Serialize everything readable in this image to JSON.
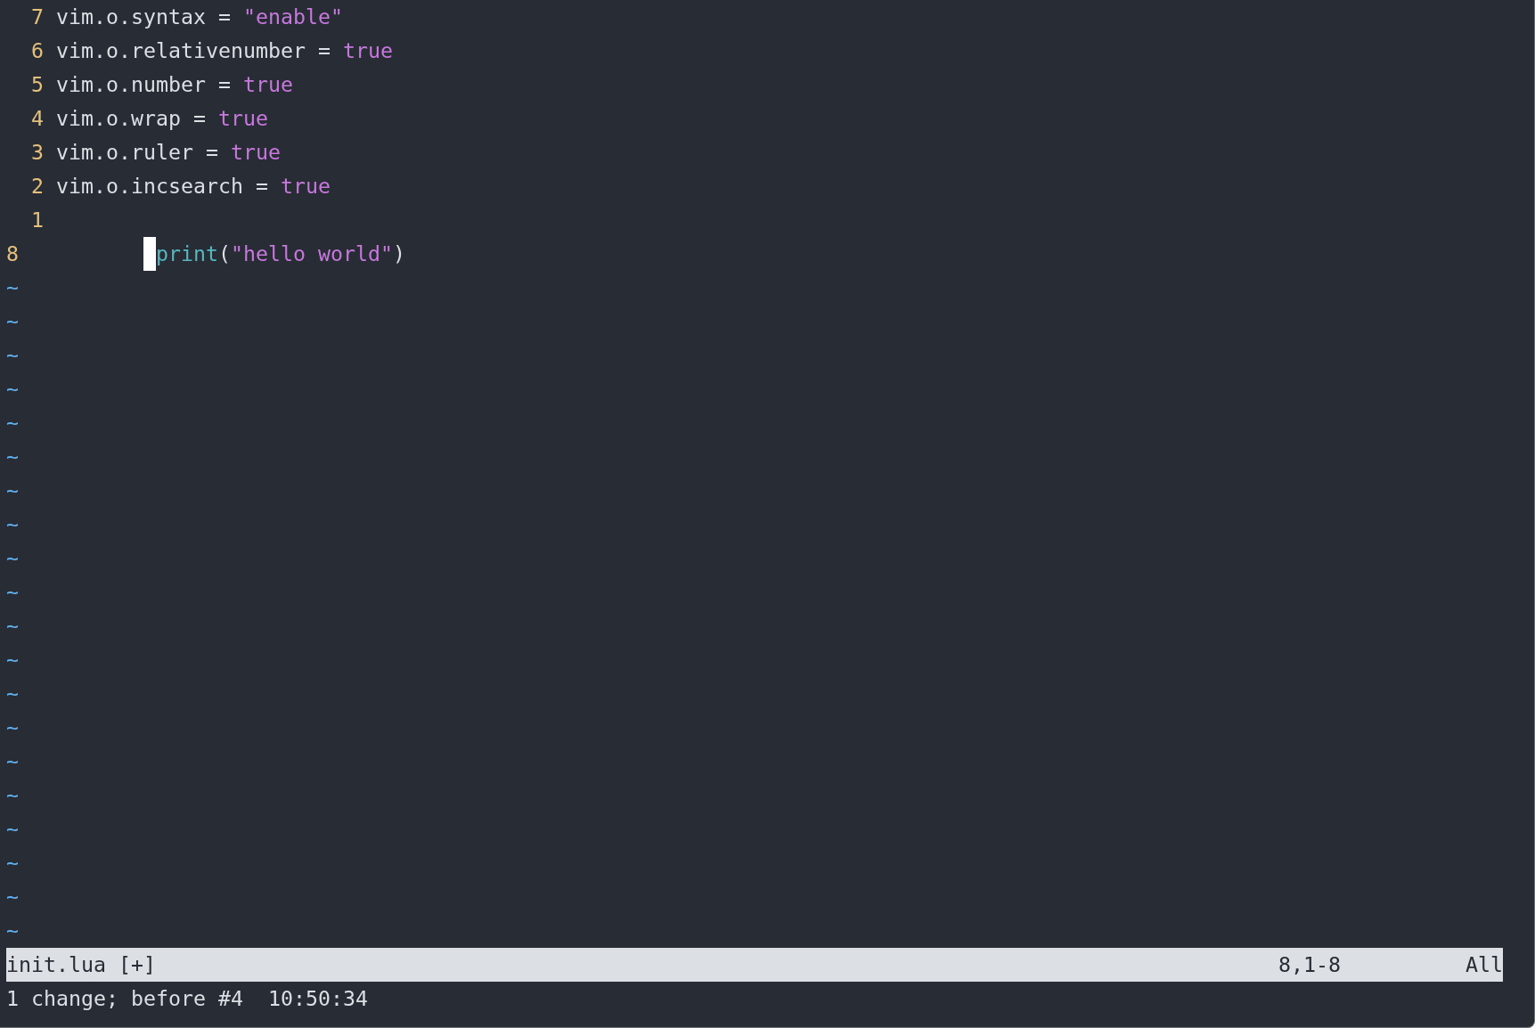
{
  "editor": {
    "lines": [
      {
        "number": "7",
        "cursor": false,
        "tokens": [
          {
            "kind": "plain",
            "text": "vim.o.syntax = "
          },
          {
            "kind": "string",
            "text": "\"enable\""
          }
        ]
      },
      {
        "number": "6",
        "cursor": false,
        "tokens": [
          {
            "kind": "plain",
            "text": "vim.o.relativenumber = "
          },
          {
            "kind": "boolean",
            "text": "true"
          }
        ]
      },
      {
        "number": "5",
        "cursor": false,
        "tokens": [
          {
            "kind": "plain",
            "text": "vim.o.number = "
          },
          {
            "kind": "boolean",
            "text": "true"
          }
        ]
      },
      {
        "number": "4",
        "cursor": false,
        "tokens": [
          {
            "kind": "plain",
            "text": "vim.o.wrap = "
          },
          {
            "kind": "boolean",
            "text": "true"
          }
        ]
      },
      {
        "number": "3",
        "cursor": false,
        "tokens": [
          {
            "kind": "plain",
            "text": "vim.o.ruler = "
          },
          {
            "kind": "boolean",
            "text": "true"
          }
        ]
      },
      {
        "number": "2",
        "cursor": false,
        "tokens": [
          {
            "kind": "plain",
            "text": "vim.o.incsearch = "
          },
          {
            "kind": "boolean",
            "text": "true"
          }
        ]
      },
      {
        "number": "1",
        "cursor": false
      },
      {
        "number": "8",
        "cursor": true,
        "tokens": [
          {
            "kind": "function",
            "text": "print"
          },
          {
            "kind": "plain",
            "text": "("
          },
          {
            "kind": "string",
            "text": "\"hello world\""
          },
          {
            "kind": "plain",
            "text": ")"
          }
        ]
      }
    ],
    "filler": [
      "~",
      "~",
      "~",
      "~",
      "~",
      "~",
      "~",
      "~",
      "~",
      "~",
      "~",
      "~",
      "~",
      "~",
      "~",
      "~",
      "~",
      "~",
      "~",
      "~"
    ]
  },
  "status_line": {
    "file": "init.lua [+]",
    "position": "8,1-8",
    "scroll": "All"
  },
  "message": "1 change; before #4  10:50:34"
}
